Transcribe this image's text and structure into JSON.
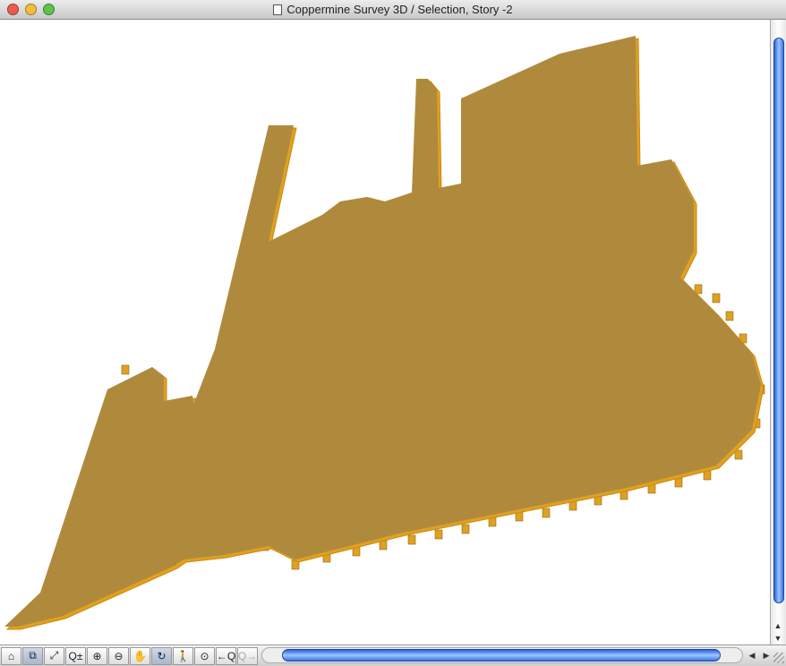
{
  "window": {
    "title": "Coppermine Survey 3D / Selection, Story -2"
  },
  "colors": {
    "slab": "#b08a3c",
    "edge": "#f0a818",
    "close": "#ee5a4f",
    "minimize": "#f3bd3b",
    "zoom": "#5fc24a"
  },
  "toolbar": {
    "tools": [
      {
        "name": "3d-view-icon",
        "glyph": "⌂"
      },
      {
        "name": "zoom-box-icon",
        "glyph": "⧉"
      },
      {
        "name": "fit-icon",
        "glyph": "⤢"
      },
      {
        "name": "zoom-plusminus-icon",
        "glyph": "Q±"
      },
      {
        "name": "zoom-in-icon",
        "glyph": "⊕"
      },
      {
        "name": "zoom-out-icon",
        "glyph": "⊖"
      },
      {
        "name": "pan-hand-icon",
        "glyph": "✋"
      },
      {
        "name": "orbit-icon",
        "glyph": "↻"
      },
      {
        "name": "walk-icon",
        "glyph": "🚶"
      },
      {
        "name": "fit-window-icon",
        "glyph": "⊙"
      },
      {
        "name": "previous-zoom-icon",
        "glyph": "←Q"
      },
      {
        "name": "next-zoom-icon",
        "glyph": "Q→"
      }
    ]
  }
}
